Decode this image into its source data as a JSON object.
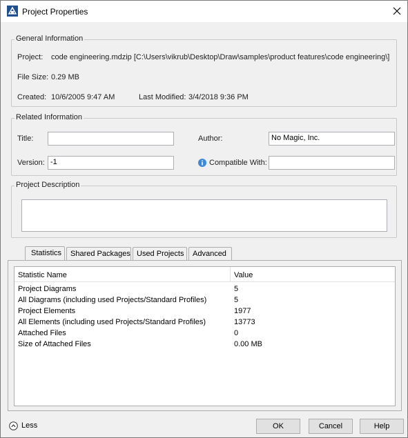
{
  "window": {
    "title": "Project Properties"
  },
  "general": {
    "legend": "General Information",
    "project_label": "Project:",
    "project_value": "code engineering.mdzip [C:\\Users\\vikrub\\Desktop\\Draw\\samples\\product features\\code engineering\\]",
    "filesize_label": "File Size:",
    "filesize_value": "0.29 MB",
    "created_label": "Created:",
    "created_value": "10/6/2005 9:47 AM",
    "modified_label": "Last Modified:",
    "modified_value": "3/4/2018 9:36 PM"
  },
  "related": {
    "legend": "Related Information",
    "title_label": "Title:",
    "title_value": "",
    "author_label": "Author:",
    "author_value": "No Magic, Inc.",
    "version_label": "Version:",
    "version_value": "-1",
    "compatible_label": "Compatible With:",
    "compatible_value": ""
  },
  "description": {
    "legend": "Project Description",
    "value": ""
  },
  "tabs": [
    {
      "label": "Statistics",
      "active": true
    },
    {
      "label": "Shared Packages",
      "active": false
    },
    {
      "label": "Used Projects",
      "active": false
    },
    {
      "label": "Advanced",
      "active": false
    }
  ],
  "statistics": {
    "headers": [
      "Statistic Name",
      "Value"
    ],
    "rows": [
      {
        "name": "Project Diagrams",
        "value": "5"
      },
      {
        "name": "All Diagrams (including used Projects/Standard Profiles)",
        "value": "5"
      },
      {
        "name": "Project Elements",
        "value": "1977"
      },
      {
        "name": "All Elements (including used Projects/Standard  Profiles)",
        "value": "13773"
      },
      {
        "name": "Attached Files",
        "value": "0"
      },
      {
        "name": "Size of Attached Files",
        "value": "0.00 MB"
      }
    ]
  },
  "footer": {
    "less_label": "Less",
    "ok_label": "OK",
    "cancel_label": "Cancel",
    "help_label": "Help"
  },
  "icons": {
    "app": "magicdraw-app-icon",
    "close": "close-icon",
    "info": "info-icon",
    "less": "chevron-up-circle-icon"
  },
  "colors": {
    "info_blue": "#3c8ad8",
    "app_icon_blue": "#1f4f8f"
  }
}
